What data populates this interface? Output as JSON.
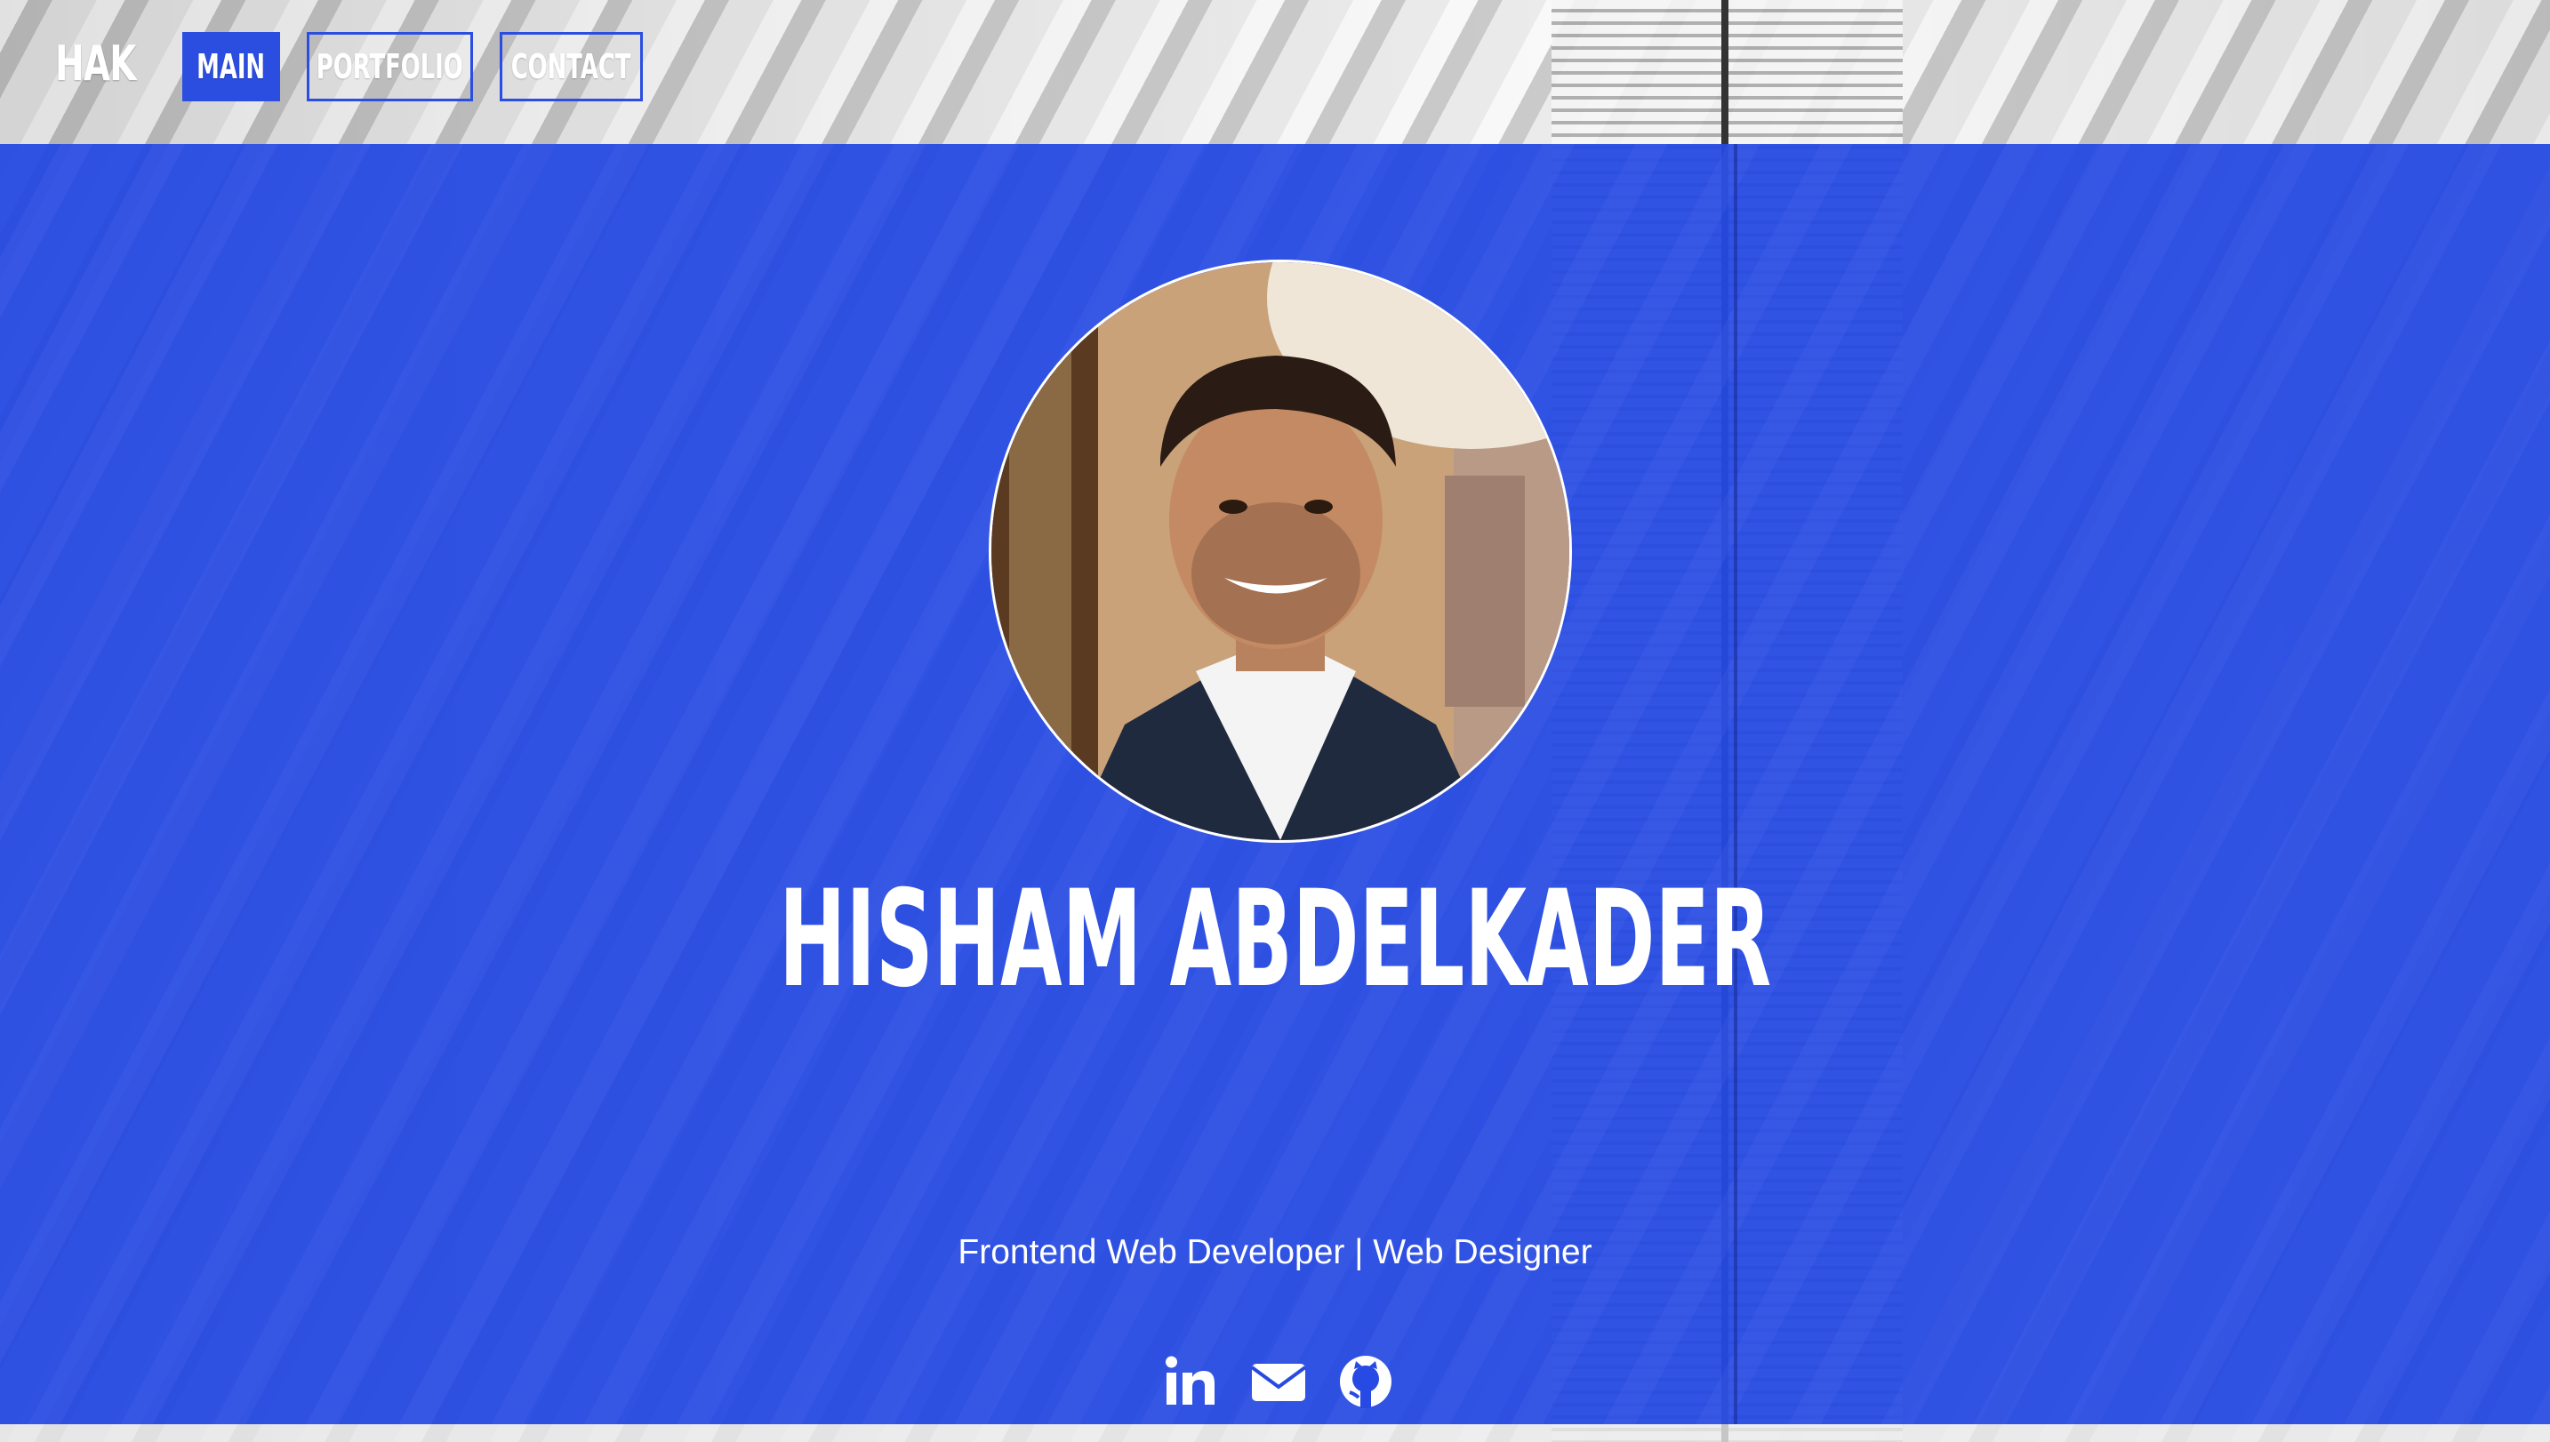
{
  "nav": {
    "brand": "HAK",
    "items": [
      {
        "label": "MAIN",
        "active": true
      },
      {
        "label": "PORTFOLIO",
        "active": false
      },
      {
        "label": "CONTACT",
        "active": false
      }
    ]
  },
  "hero": {
    "name": "HISHAM ABDELKADER",
    "tagline": "Frontend Web Developer | Web Designer",
    "avatar_icon": "profile-photo",
    "socials": [
      {
        "icon": "linkedin-icon"
      },
      {
        "icon": "email-icon"
      },
      {
        "icon": "github-icon"
      }
    ]
  },
  "colors": {
    "accent": "#2b4ee0",
    "hero_overlay": "#264ae3",
    "text": "#ffffff"
  }
}
